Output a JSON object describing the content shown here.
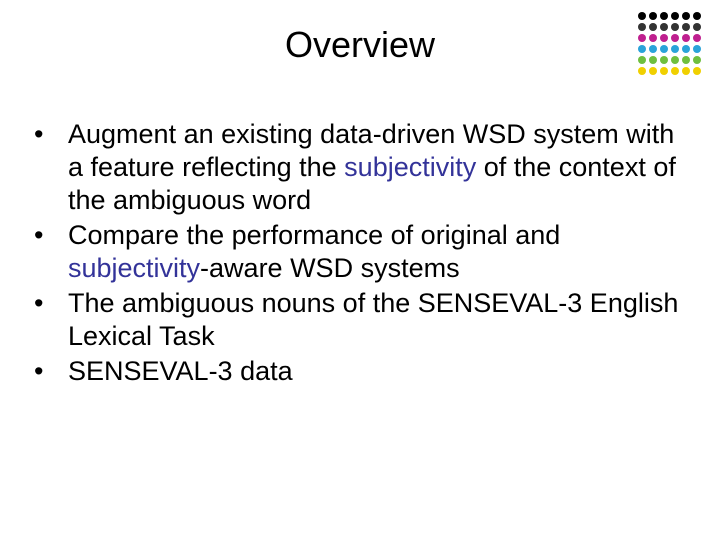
{
  "title": "Overview",
  "bullets": {
    "b1_pre": "Augment an existing data-driven WSD system with a feature reflecting the ",
    "b1_subj": "subjectivity",
    "b1_post": " of the context of the ambiguous word",
    "b2_pre": "Compare the performance of original and ",
    "b2_subj": "subjectivity",
    "b2_post": "-aware WSD systems",
    "b3": "The ambiguous nouns of the SENSEVAL-3 English Lexical Task",
    "b4": "SENSEVAL-3 data"
  },
  "dot_colors": {
    "r1": "#000000",
    "r2": "#333333",
    "r3": "#bf1f8f",
    "r4": "#2aa3d9",
    "r5": "#6fbf3f",
    "r6": "#f0d000"
  }
}
